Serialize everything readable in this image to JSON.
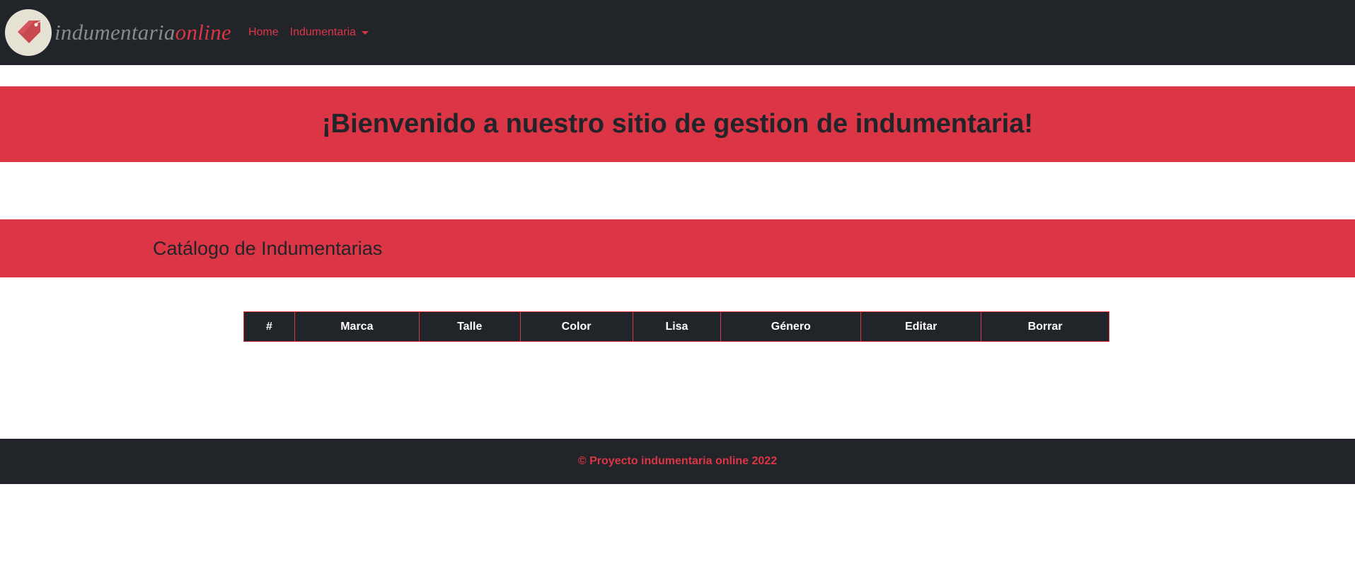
{
  "brand": {
    "text_part1": "indumentaria",
    "text_part2": "online",
    "logo_icon": "price-tag-icon"
  },
  "nav": {
    "items": [
      {
        "label": "Home"
      },
      {
        "label": "Indumentaria",
        "dropdown": true
      }
    ]
  },
  "hero": {
    "title": "¡Bienvenido a nuestro sitio de gestion de indumentaria!"
  },
  "section": {
    "title": "Catálogo de Indumentarias"
  },
  "table": {
    "columns": [
      "#",
      "Marca",
      "Talle",
      "Color",
      "Lisa",
      "Género",
      "Editar",
      "Borrar"
    ],
    "rows": []
  },
  "footer": {
    "text": "© Proyecto indumentaria online 2022"
  },
  "colors": {
    "accent": "#dc3545",
    "dark": "#212529",
    "logo_bg": "#e6e2d3",
    "brand_gray": "#8a8a8a"
  }
}
